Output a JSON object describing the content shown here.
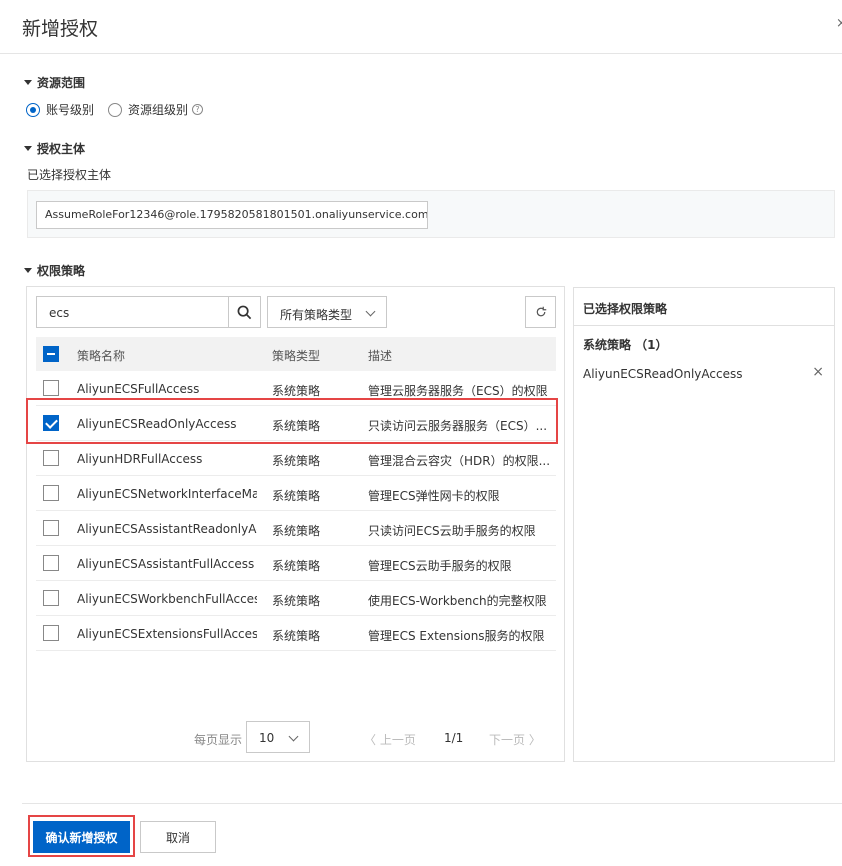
{
  "dialog": {
    "title": "新增授权",
    "close_glyph": "×"
  },
  "scope": {
    "section_title": "资源范围",
    "options": [
      {
        "label": "账号级别",
        "checked": true
      },
      {
        "label": "资源组级别",
        "checked": false
      }
    ],
    "help_glyph": "?"
  },
  "principal": {
    "section_title": "授权主体",
    "selected_label": "已选择授权主体",
    "value": "AssumeRoleFor12346@role.1795820581801501.onaliyunservice.com"
  },
  "policies": {
    "section_title": "权限策略",
    "search": {
      "value": "ecs"
    },
    "type_filter": {
      "selected": "所有策略类型"
    },
    "columns": {
      "name": "策略名称",
      "type": "策略类型",
      "desc": "描述"
    },
    "rows": [
      {
        "name": "AliyunECSFullAccess",
        "type": "系统策略",
        "desc": "管理云服务器服务（ECS）的权限",
        "checked": false
      },
      {
        "name": "AliyunECSReadOnlyAccess",
        "type": "系统策略",
        "desc": "只读访问云服务器服务（ECS）...",
        "checked": true
      },
      {
        "name": "AliyunHDRFullAccess",
        "type": "系统策略",
        "desc": "管理混合云容灾（HDR）的权限...",
        "checked": false
      },
      {
        "name": "AliyunECSNetworkInterfaceMan...",
        "type": "系统策略",
        "desc": "管理ECS弹性网卡的权限",
        "checked": false
      },
      {
        "name": "AliyunECSAssistantReadonlyAcc...",
        "type": "系统策略",
        "desc": "只读访问ECS云助手服务的权限",
        "checked": false
      },
      {
        "name": "AliyunECSAssistantFullAccess",
        "type": "系统策略",
        "desc": "管理ECS云助手服务的权限",
        "checked": false
      },
      {
        "name": "AliyunECSWorkbenchFullAccess",
        "type": "系统策略",
        "desc": "使用ECS-Workbench的完整权限",
        "checked": false
      },
      {
        "name": "AliyunECSExtensionsFullAccess",
        "type": "系统策略",
        "desc": "管理ECS Extensions服务的权限",
        "checked": false
      }
    ],
    "pager": {
      "per_page_label": "每页显示",
      "per_page": "10",
      "prev": "〈 上一页",
      "page": "1/1",
      "next": "下一页 〉"
    }
  },
  "selected_panel": {
    "title": "已选择权限策略",
    "group_label": "系统策略 （1）",
    "items": [
      {
        "name": "AliyunECSReadOnlyAccess"
      }
    ],
    "remove_glyph": "×"
  },
  "footer": {
    "confirm_label": "确认新增授权",
    "cancel_label": "取消"
  },
  "colors": {
    "primary": "#0064c8",
    "highlight": "#e54545"
  }
}
